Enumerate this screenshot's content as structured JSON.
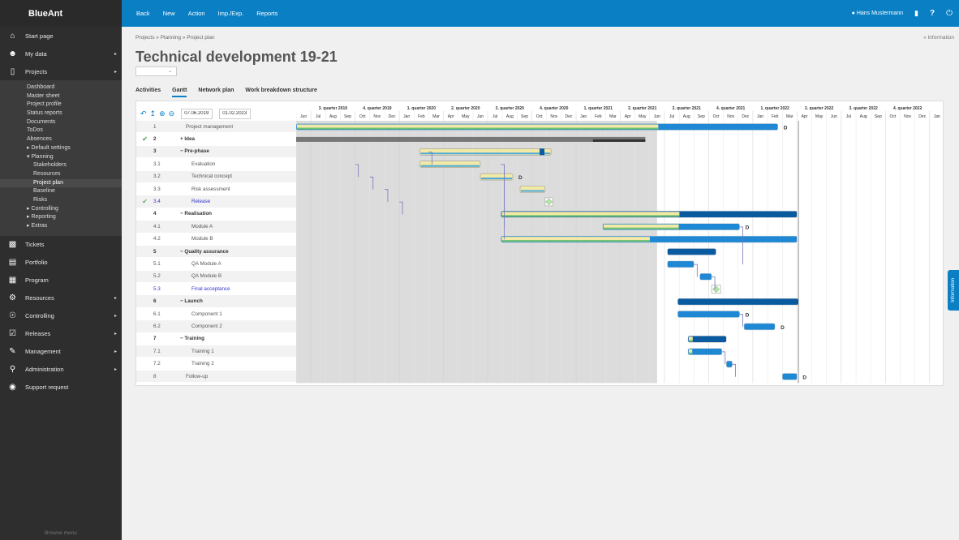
{
  "app": {
    "logo": "BlueAnt"
  },
  "topbar": {
    "items": [
      "Back",
      "New",
      "Action",
      "Imp./Exp.",
      "Reports"
    ],
    "user": "Hans Mustermann",
    "help": "?"
  },
  "sidebar": {
    "main": [
      {
        "label": "Start page",
        "icon": "home-icon",
        "arrow": false
      },
      {
        "label": "My data",
        "icon": "person-icon",
        "arrow": true
      },
      {
        "label": "Projects",
        "icon": "folder-icon",
        "arrow": true
      }
    ],
    "sub": [
      {
        "label": "Dashboard",
        "level": 1
      },
      {
        "label": "Master sheet",
        "level": 1
      },
      {
        "label": "Project profile",
        "level": 1
      },
      {
        "label": "Status reports",
        "level": 1
      },
      {
        "label": "Documents",
        "level": 1
      },
      {
        "label": "ToDos",
        "level": 1
      },
      {
        "label": "Absences",
        "level": 1
      },
      {
        "label": "▸ Default settings",
        "level": 0
      },
      {
        "label": "▾ Planning",
        "level": 0
      },
      {
        "label": "Stakeholders",
        "level": 2
      },
      {
        "label": "Resources",
        "level": 2
      },
      {
        "label": "Project plan",
        "level": 2,
        "active": true
      },
      {
        "label": "Baseline",
        "level": 2
      },
      {
        "label": "Risks",
        "level": 2
      },
      {
        "label": "▸ Controlling",
        "level": 0
      },
      {
        "label": "▸ Reporting",
        "level": 0
      },
      {
        "label": "▸ Extras",
        "level": 0
      }
    ],
    "bottom": [
      {
        "label": "Tickets",
        "icon": "tickets-icon",
        "arrow": false
      },
      {
        "label": "Portfolio",
        "icon": "portfolio-icon",
        "arrow": false
      },
      {
        "label": "Program",
        "icon": "program-icon",
        "arrow": false
      },
      {
        "label": "Resources",
        "icon": "resources-icon",
        "arrow": true
      },
      {
        "label": "Controlling",
        "icon": "controlling-icon",
        "arrow": true
      },
      {
        "label": "Releases",
        "icon": "releases-icon",
        "arrow": true
      },
      {
        "label": "Management",
        "icon": "management-icon",
        "arrow": true
      },
      {
        "label": "Administration",
        "icon": "key-icon",
        "arrow": true
      },
      {
        "label": "Support request",
        "icon": "support-icon",
        "arrow": false
      }
    ],
    "browse": "Browse menu"
  },
  "page": {
    "breadcrumb": "Projects » Planning » Project plan",
    "info_link": "« Information",
    "title": "Technical development 19-21",
    "tabs": [
      "Activities",
      "Gantt",
      "Network plan",
      "Work breakdown structure"
    ],
    "active_tab": "Gantt",
    "date_from": "07.06.2019",
    "date_to": "01.02.2023",
    "info_tab": "Information"
  },
  "gantt": {
    "quarters": [
      "3. quarter 2019",
      "4. quarter 2019",
      "1. quarter 2020",
      "2. quarter 2020",
      "3. quarter 2020",
      "4. quarter 2020",
      "1. quarter 2021",
      "2. quarter 2021",
      "3. quarter 2021",
      "4. quarter 2021",
      "1. quarter 2022",
      "2. quarter 2022",
      "3. quarter 2022",
      "4. quarter 2022"
    ],
    "months": [
      "Jun",
      "Jul",
      "Aug",
      "Sep",
      "Oct",
      "Nov",
      "Dec",
      "Jan",
      "Feb",
      "Mar",
      "Apr",
      "May",
      "Jun",
      "Jul",
      "Aug",
      "Sep",
      "Oct",
      "Nov",
      "Dec",
      "Jan",
      "Feb",
      "Mar",
      "Apr",
      "May",
      "Jun",
      "Jul",
      "Aug",
      "Sep",
      "Oct",
      "Nov",
      "Dec",
      "Jan",
      "Feb",
      "Mar",
      "Apr",
      "May",
      "Jun",
      "Jul",
      "Aug",
      "Sep",
      "Oct",
      "Nov",
      "Dec",
      "Jan"
    ],
    "rows": [
      {
        "num": "1",
        "name": "Project management",
        "check": false,
        "bold": false,
        "link": false,
        "indent": 0
      },
      {
        "num": "2",
        "name": "+ Idea",
        "check": true,
        "bold": true,
        "link": false,
        "indent": 0
      },
      {
        "num": "3",
        "name": "− Pre-phase",
        "check": false,
        "bold": true,
        "link": false,
        "indent": 0
      },
      {
        "num": "3.1",
        "name": "Evaluation",
        "check": false,
        "bold": false,
        "link": false,
        "indent": 1
      },
      {
        "num": "3.2",
        "name": "Technical concept",
        "check": false,
        "bold": false,
        "link": false,
        "indent": 1
      },
      {
        "num": "3.3",
        "name": "Risk assessment",
        "check": false,
        "bold": false,
        "link": false,
        "indent": 1
      },
      {
        "num": "3.4",
        "name": "Release",
        "check": true,
        "bold": false,
        "link": true,
        "indent": 1
      },
      {
        "num": "4",
        "name": "− Realisation",
        "check": false,
        "bold": true,
        "link": false,
        "indent": 0
      },
      {
        "num": "4.1",
        "name": "Module A",
        "check": false,
        "bold": false,
        "link": false,
        "indent": 1
      },
      {
        "num": "4.2",
        "name": "Module B",
        "check": false,
        "bold": false,
        "link": false,
        "indent": 1
      },
      {
        "num": "5",
        "name": "− Quality assurance",
        "check": false,
        "bold": true,
        "link": false,
        "indent": 0
      },
      {
        "num": "5.1",
        "name": "QA Module A",
        "check": false,
        "bold": false,
        "link": false,
        "indent": 1
      },
      {
        "num": "5.2",
        "name": "QA Module B",
        "check": false,
        "bold": false,
        "link": false,
        "indent": 1
      },
      {
        "num": "5.3",
        "name": "Final acceptance",
        "check": false,
        "bold": false,
        "link": true,
        "indent": 1
      },
      {
        "num": "6",
        "name": "− Launch",
        "check": false,
        "bold": true,
        "link": false,
        "indent": 0
      },
      {
        "num": "6.1",
        "name": "Component 1",
        "check": false,
        "bold": false,
        "link": false,
        "indent": 1
      },
      {
        "num": "6.2",
        "name": "Component 2",
        "check": false,
        "bold": false,
        "link": false,
        "indent": 1
      },
      {
        "num": "7",
        "name": "− Training",
        "check": false,
        "bold": true,
        "link": false,
        "indent": 0
      },
      {
        "num": "7.1",
        "name": "Training 1",
        "check": false,
        "bold": false,
        "link": false,
        "indent": 1
      },
      {
        "num": "7.2",
        "name": "Training 2",
        "check": false,
        "bold": false,
        "link": false,
        "indent": 1
      },
      {
        "num": "8",
        "name": "Follow-up",
        "check": false,
        "bold": false,
        "link": false,
        "indent": 0
      }
    ],
    "bars": [
      {
        "row": 0,
        "start": 0,
        "end": 32.7,
        "type": "task",
        "progress": 0.75,
        "label": "D"
      },
      {
        "row": 1,
        "start": 0,
        "end": 23.7,
        "type": "grey"
      },
      {
        "row": 2,
        "start": 8.4,
        "end": 17.3,
        "type": "summary-light",
        "progress": 0.95
      },
      {
        "row": 3,
        "start": 8.4,
        "end": 12.5,
        "type": "light"
      },
      {
        "row": 4,
        "start": 12.5,
        "end": 14.7,
        "type": "light",
        "label": "D"
      },
      {
        "row": 5,
        "start": 15.2,
        "end": 16.9,
        "type": "light"
      },
      {
        "row": 6,
        "start": 16.9,
        "end": 17.3,
        "type": "milestone"
      },
      {
        "row": 7,
        "start": 13.9,
        "end": 34,
        "type": "summary",
        "progress": 0.6
      },
      {
        "row": 8,
        "start": 20.8,
        "end": 30.1,
        "type": "task",
        "progress": 0.55,
        "label": "D"
      },
      {
        "row": 9,
        "start": 13.9,
        "end": 34,
        "type": "task",
        "progress": 0.5
      },
      {
        "row": 10,
        "start": 25.2,
        "end": 28.5,
        "type": "summary",
        "progress": 0
      },
      {
        "row": 11,
        "start": 25.2,
        "end": 27,
        "type": "task",
        "progress": 0
      },
      {
        "row": 12,
        "start": 27.4,
        "end": 28.2,
        "type": "task",
        "progress": 0
      },
      {
        "row": 13,
        "start": 28.2,
        "end": 28.7,
        "type": "milestone"
      },
      {
        "row": 14,
        "start": 25.9,
        "end": 34.1,
        "type": "summary",
        "progress": 0
      },
      {
        "row": 15,
        "start": 25.9,
        "end": 30.1,
        "type": "task",
        "progress": 0,
        "label": "D"
      },
      {
        "row": 16,
        "start": 30.4,
        "end": 32.5,
        "type": "task",
        "progress": 0,
        "label": "D"
      },
      {
        "row": 17,
        "start": 26.6,
        "end": 29.2,
        "type": "summary",
        "progress": 0.1
      },
      {
        "row": 18,
        "start": 26.6,
        "end": 28.9,
        "type": "task",
        "progress": 0.1
      },
      {
        "row": 19,
        "start": 29.2,
        "end": 29.6,
        "type": "task",
        "progress": 0
      },
      {
        "row": 20,
        "start": 33,
        "end": 34,
        "type": "task",
        "progress": 0,
        "label": "D"
      }
    ],
    "shaded_months": 24.5,
    "today_month": 34.1
  }
}
